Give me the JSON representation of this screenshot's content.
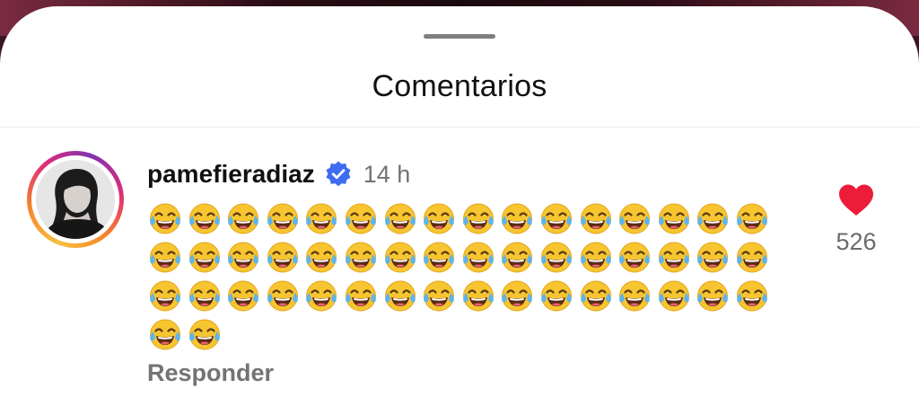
{
  "sheet": {
    "title": "Comentarios"
  },
  "comment": {
    "username": "pamefieradiaz",
    "verified": true,
    "time": "14 h",
    "emoji_name": "face-with-tears-of-joy",
    "emoji_lines": [
      16,
      16,
      16,
      2
    ],
    "emoji_total": 50,
    "reply_label": "Responder",
    "likes": "526",
    "liked": true
  },
  "colors": {
    "like": "#ed1c3a",
    "verified": "#3f6bf0",
    "muted_text": "#737373"
  },
  "icons": {
    "verified": "verified-badge-icon",
    "like": "heart-icon",
    "avatar": "profile-photo"
  }
}
